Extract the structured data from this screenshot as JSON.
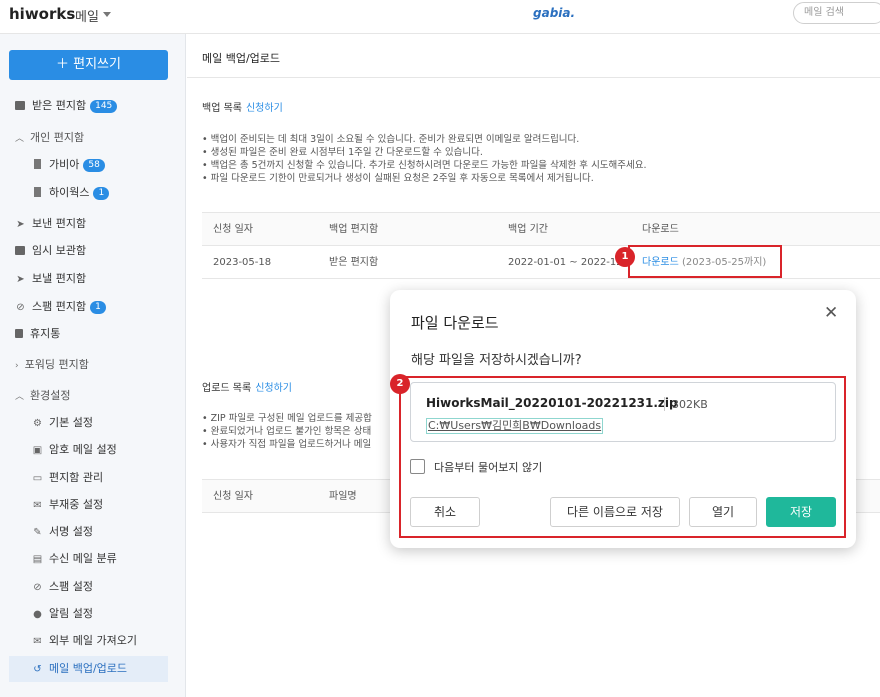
{
  "header": {
    "logo": "hiworks",
    "app_name": "메일",
    "brand": "gabia.",
    "search_placeholder": "메일 검색"
  },
  "sidebar": {
    "compose_label": "편지쓰기",
    "items": [
      {
        "label": "받은 편지함",
        "badge": "145"
      },
      {
        "label": "개인 편지함"
      },
      {
        "label": "가비아",
        "badge": "58"
      },
      {
        "label": "하이웍스",
        "badge": "1"
      },
      {
        "label": "보낸 편지함"
      },
      {
        "label": "임시 보관함"
      },
      {
        "label": "보낼 편지함"
      },
      {
        "label": "스팸 편지함",
        "badge": "1"
      },
      {
        "label": "휴지통"
      },
      {
        "label": "포워딩 편지함"
      },
      {
        "label": "환경설정"
      },
      {
        "label": "기본 설정"
      },
      {
        "label": "암호 메일 설정"
      },
      {
        "label": "편지함 관리"
      },
      {
        "label": "부재중 설정"
      },
      {
        "label": "서명 설정"
      },
      {
        "label": "수신 메일 분류"
      },
      {
        "label": "스팸 설정"
      },
      {
        "label": "알림 설정"
      },
      {
        "label": "외부 메일 가져오기"
      },
      {
        "label": "메일 백업/업로드"
      }
    ]
  },
  "main": {
    "page_title": "메일 백업/업로드",
    "backup": {
      "title": "백업 목록",
      "apply": "신청하기",
      "notes": [
        "• 백업이 준비되는 데 최대 3일이 소요될 수 있습니다. 준비가 완료되면 이메일로 알려드립니다.",
        "• 생성된 파일은 준비 완료 시점부터 1주일 간 다운로드할 수 있습니다.",
        "• 백업은 총 5건까지 신청할 수 있습니다. 추가로 신청하시려면 다운로드 가능한 파일을 삭제한 후 시도해주세요.",
        "• 파일 다운로드 기한이 만료되거나 생성이 실패된 요청은 2주일 후 자동으로 목록에서 제거됩니다."
      ],
      "columns": [
        "신청 일자",
        "백업 편지함",
        "백업 기간",
        "다운로드"
      ],
      "row": {
        "date": "2023-05-18",
        "folder": "받은 편지함",
        "period": "2022-01-01 ~ 2022-12-3",
        "download": "다운로드",
        "download_until": "(2023-05-25까지)"
      }
    },
    "upload": {
      "title": "업로드 목록",
      "apply": "신청하기",
      "notes": [
        "• ZIP 파일로 구성된 메일 업로드를 제공합",
        "• 완료되었거나 업로드 불가인 항목은 상태",
        "• 사용자가 직접 파일을 업로드하거나 메일"
      ],
      "columns": [
        "신청 일자",
        "파일명"
      ]
    }
  },
  "markers": [
    "1",
    "2"
  ],
  "dialog": {
    "title": "파일 다운로드",
    "close": "✕",
    "message": "해당 파일을 저장하시겠습니까?",
    "file_name": "HiworksMail_20220101-20221231.zip",
    "file_size": "302KB",
    "file_path": "C:₩Users₩김민희B₩Downloads",
    "checkbox_label": "다음부터 물어보지 않기",
    "buttons": {
      "cancel": "취소",
      "save_as": "다른 이름으로 저장",
      "open": "열기",
      "save": "저장"
    }
  },
  "colors": {
    "accent": "#2a8de4",
    "primary_button": "#1fb89b",
    "highlight": "#d9242a"
  }
}
